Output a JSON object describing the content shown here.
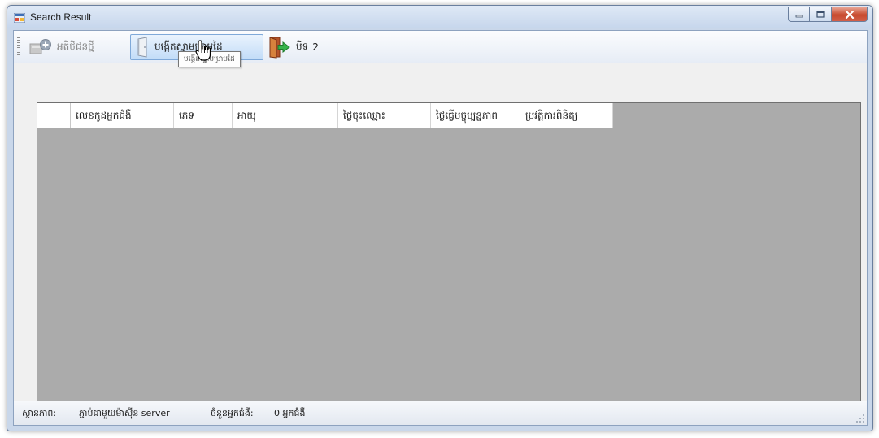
{
  "window": {
    "title": "Search Result"
  },
  "toolbar": {
    "new_label": "អតិថិជនថ្មី",
    "create_label": "បង្កើតស្នាមម្រាមដៃ",
    "close_label": "បិទ",
    "badge": "2"
  },
  "tooltip": {
    "text": "បង្កើតស្នាមម្រាមដៃ"
  },
  "grid": {
    "columns": [
      "លេខកូដអ្នកជំងឺ",
      "ភេទ",
      "អាយុ",
      "ថ្ងៃចុះឈ្មោះ",
      "ថ្ងៃធ្វើបច្ចុប្បន្នភាព",
      "ប្រវត្តិការពិនិត្យ"
    ]
  },
  "status": {
    "state_label": "ស្ថានភាព:",
    "state_value": "ភ្ជាប់ជាមួយម៉ាស៊ីន server",
    "count_label": "ចំនួនអ្នកជំងឺ:",
    "count_value": "0 អ្នកជំងឺ"
  },
  "colors": {
    "grid_background": "#ababab",
    "hover_highlight": "#c2dcf8",
    "close_button": "#c74a2e"
  },
  "icons": {
    "app": "app-window-icon",
    "new": "add-customer-icon",
    "create": "fingerprint-door-icon",
    "close": "exit-door-icon"
  }
}
